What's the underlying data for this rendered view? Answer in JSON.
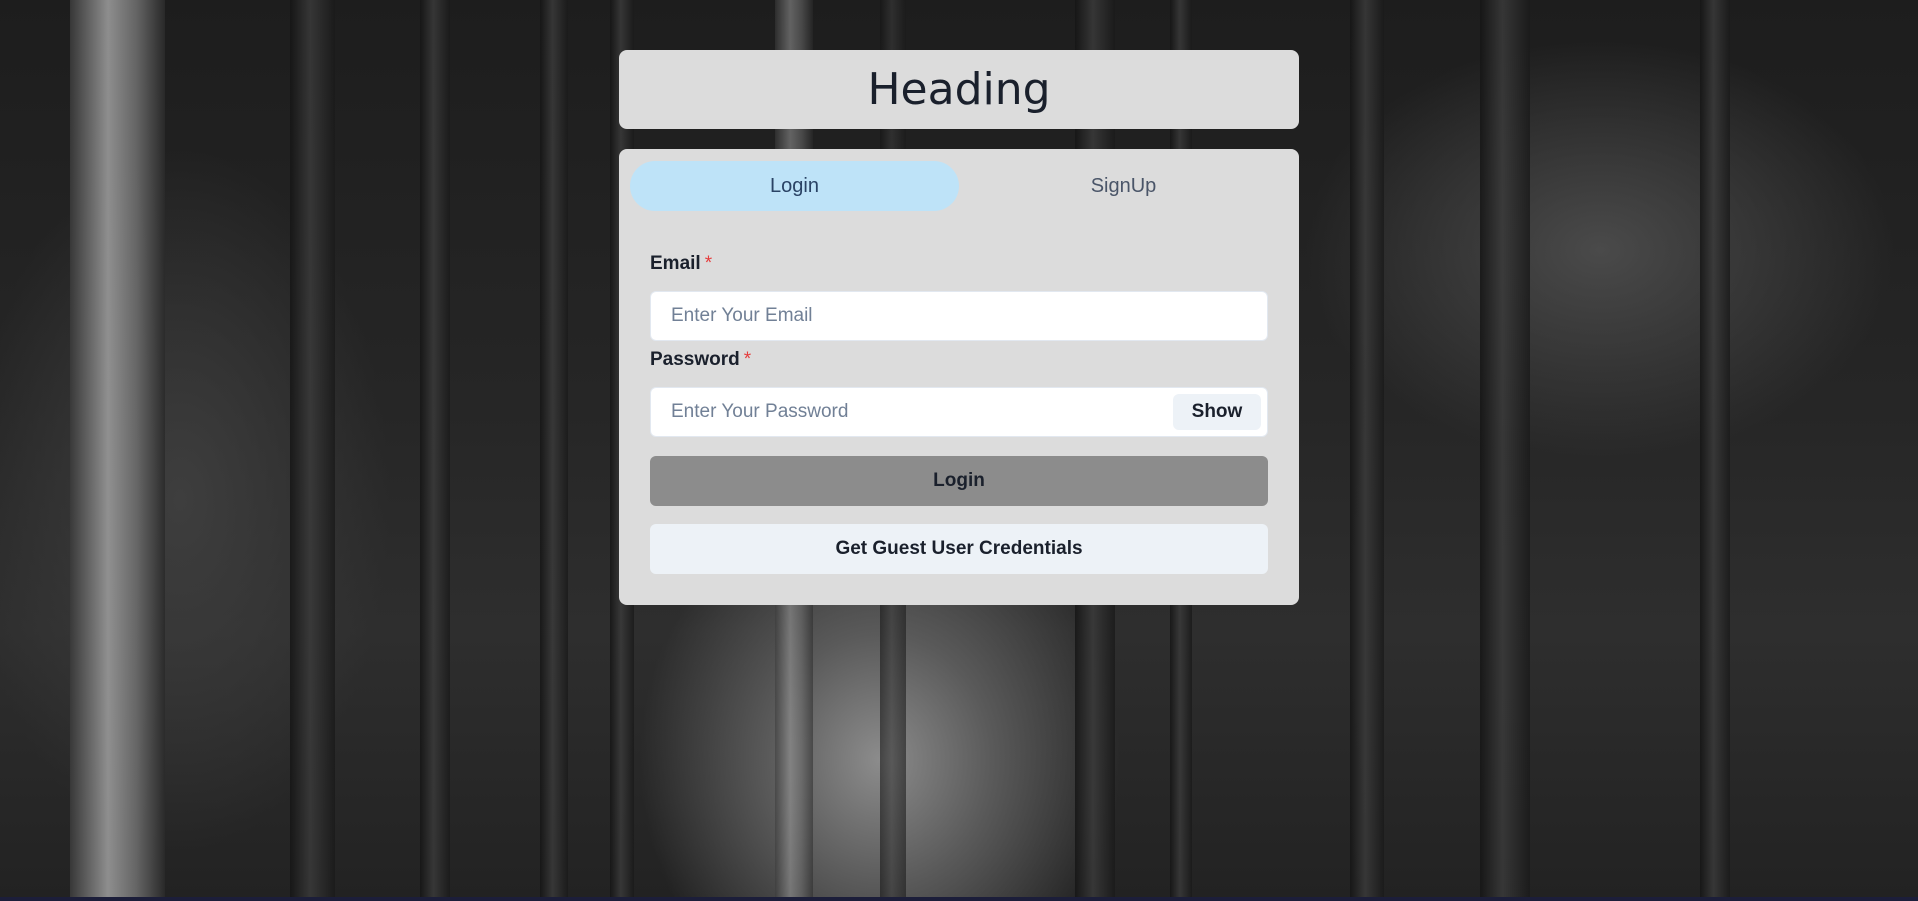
{
  "heading": "Heading",
  "tabs": [
    {
      "label": "Login",
      "active": true
    },
    {
      "label": "SignUp",
      "active": false
    }
  ],
  "email": {
    "label": "Email",
    "required_mark": "*",
    "placeholder": "Enter Your Email",
    "value": ""
  },
  "password": {
    "label": "Password",
    "required_mark": "*",
    "placeholder": "Enter Your Password",
    "value": "",
    "toggle_label": "Show"
  },
  "login_button": "Login",
  "guest_button": "Get Guest User Credentials",
  "colors": {
    "card_bg": "#dcdcdc",
    "active_tab_bg": "#bee3f8",
    "primary_button_bg": "#8c8c8c",
    "secondary_button_bg": "#edf2f7",
    "required": "#e53e3e"
  }
}
